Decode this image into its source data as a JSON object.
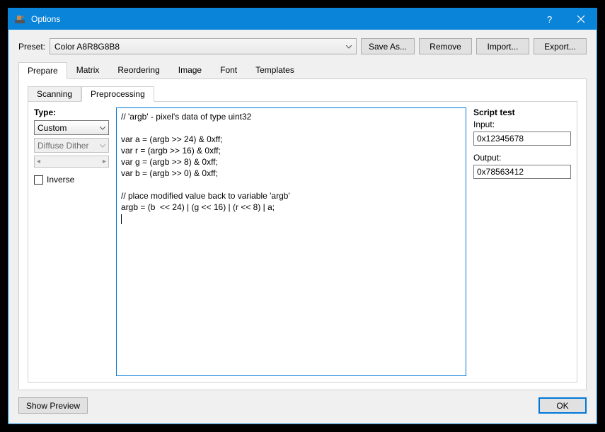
{
  "window": {
    "title": "Options"
  },
  "preset": {
    "label": "Preset:",
    "value": "Color A8R8G8B8",
    "save_as": "Save As...",
    "remove": "Remove",
    "import": "Import...",
    "export": "Export..."
  },
  "outer_tabs": [
    "Prepare",
    "Matrix",
    "Reordering",
    "Image",
    "Font",
    "Templates"
  ],
  "outer_active": 0,
  "inner_tabs": [
    "Scanning",
    "Preprocessing"
  ],
  "inner_active": 1,
  "type": {
    "label": "Type:",
    "combo1": "Custom",
    "combo2": "Diffuse Dither",
    "inverse": "Inverse"
  },
  "script": "// 'argb' - pixel's data of type uint32\n\nvar a = (argb >> 24) & 0xff;\nvar r = (argb >> 16) & 0xff;\nvar g = (argb >> 8) & 0xff;\nvar b = (argb >> 0) & 0xff;\n\n// place modified value back to variable 'argb'\nargb = (b  << 24) | (g << 16) | (r << 8) | a;\n",
  "test": {
    "header": "Script test",
    "input_label": "Input:",
    "input_value": "0x12345678",
    "output_label": "Output:",
    "output_value": "0x78563412"
  },
  "footer": {
    "show_preview": "Show Preview",
    "ok": "OK"
  }
}
